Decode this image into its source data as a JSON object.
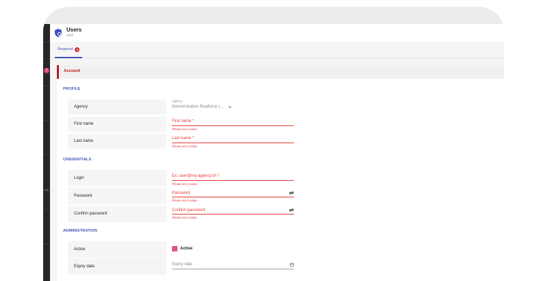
{
  "sidebar": {
    "badge": "1",
    "label": "uid"
  },
  "header": {
    "title": "Users",
    "subtitle": "add",
    "icon": "user-shield-icon"
  },
  "tabs": [
    {
      "label": "Required",
      "badge": "1"
    }
  ],
  "section": {
    "title": "Account"
  },
  "groups": {
    "profile": "PROFILE",
    "credentials": "CREDENTIALS",
    "administration": "ADMINISTRATION"
  },
  "fields": {
    "agency": {
      "label": "Agency",
      "small_label": "Agency",
      "value": "Démonstration Realforce (..."
    },
    "first_name": {
      "label": "First name",
      "placeholder": "First name *",
      "error": "Please set a value"
    },
    "last_name": {
      "label": "Last name",
      "placeholder": "Last name *",
      "error": "Please set a value"
    },
    "login": {
      "label": "Login",
      "placeholder": "Ex: user@my-agency.ch *",
      "error": "Please set a value"
    },
    "password": {
      "label": "Password",
      "placeholder": "Password",
      "error": "Please set a value"
    },
    "confirm_password": {
      "label": "Confirm password",
      "placeholder": "Confirm password",
      "error": "Please set a value"
    },
    "active": {
      "label": "Active",
      "checkbox_label": "Active",
      "checked": true
    },
    "expiry_date": {
      "label": "Expiry date",
      "placeholder": "Expiry date"
    }
  },
  "colors": {
    "primary": "#3f51b5",
    "error": "#e53935",
    "accent": "#e5507c",
    "section": "#b71c1c"
  }
}
